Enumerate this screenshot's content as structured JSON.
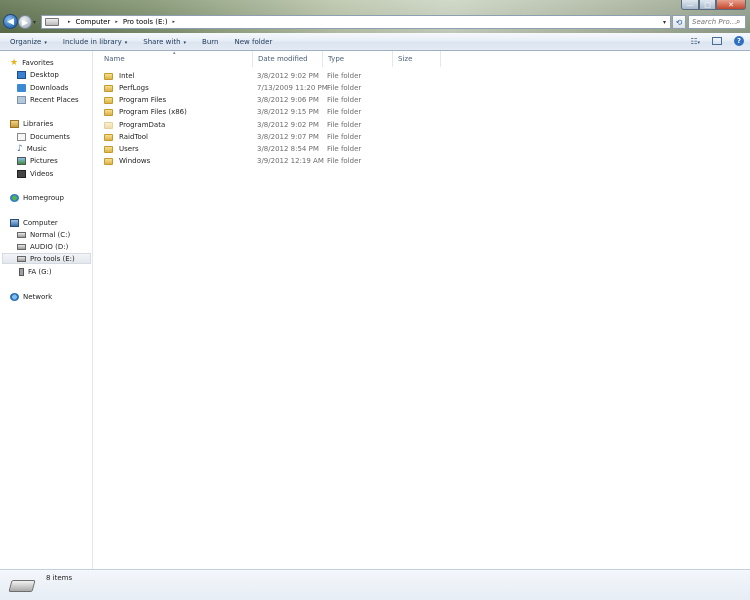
{
  "window": {
    "minimize_glyph": "—",
    "maximize_glyph": "□",
    "close_glyph": "✕"
  },
  "address_bar": {
    "crumbs": [
      "Computer",
      "Pro tools (E:)"
    ],
    "separator": "▸",
    "dropdown_glyph": "▾"
  },
  "search": {
    "placeholder": "Search Pro..."
  },
  "toolbar": {
    "organize": "Organize",
    "include_in_library": "Include in library",
    "share_with": "Share with",
    "burn": "Burn",
    "new_folder": "New folder",
    "dropdown_glyph": "▾"
  },
  "sidebar": {
    "favorites": {
      "label": "Favorites",
      "items": [
        "Desktop",
        "Downloads",
        "Recent Places"
      ]
    },
    "libraries": {
      "label": "Libraries",
      "items": [
        "Documents",
        "Music",
        "Pictures",
        "Videos"
      ]
    },
    "homegroup": {
      "label": "Homegroup"
    },
    "computer": {
      "label": "Computer",
      "items": [
        "Normal (C:)",
        "AUDIO (D:)",
        "Pro tools (E:)",
        "FA  (G:)"
      ],
      "selected": "Pro tools (E:)"
    },
    "network": {
      "label": "Network"
    }
  },
  "columns": {
    "name": "Name",
    "date": "Date modified",
    "type": "Type",
    "size": "Size"
  },
  "files": [
    {
      "name": "Intel",
      "date": "3/8/2012 9:02 PM",
      "type": "File folder"
    },
    {
      "name": "PerfLogs",
      "date": "7/13/2009 11:20 PM",
      "type": "File folder"
    },
    {
      "name": "Program Files",
      "date": "3/8/2012 9:06 PM",
      "type": "File folder"
    },
    {
      "name": "Program Files (x86)",
      "date": "3/8/2012 9:15 PM",
      "type": "File folder"
    },
    {
      "name": "ProgramData",
      "date": "3/8/2012 9:02 PM",
      "type": "File folder"
    },
    {
      "name": "RaidTool",
      "date": "3/8/2012 9:07 PM",
      "type": "File folder"
    },
    {
      "name": "Users",
      "date": "3/8/2012 8:54 PM",
      "type": "File folder"
    },
    {
      "name": "Windows",
      "date": "3/9/2012 12:19 AM",
      "type": "File folder"
    }
  ],
  "status": {
    "item_count": "8 items"
  },
  "colors": {
    "accent": "#1e395b",
    "folder": "#e8c45a"
  }
}
